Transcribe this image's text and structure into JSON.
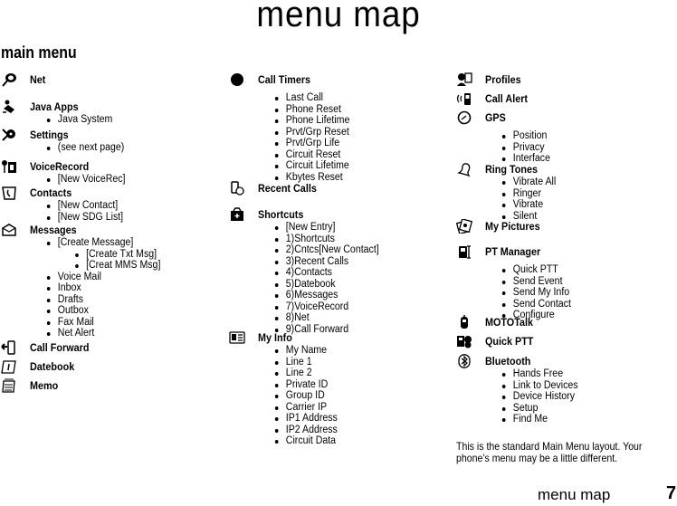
{
  "page": {
    "title": "menu map",
    "section_title": "main menu",
    "note": "This is the standard Main Menu layout. Your phone’s menu may be a little different.",
    "footer_label": "menu map",
    "page_number": "7"
  },
  "columns": [
    {
      "entries": [
        {
          "icon": "net-icon",
          "label": "Net",
          "items": []
        },
        {
          "icon": "java-apps-icon",
          "label": "Java Apps",
          "items": [
            {
              "text": "Java System"
            }
          ]
        },
        {
          "icon": "settings-icon",
          "label": "Settings",
          "items": [
            {
              "text": "(see next page)"
            }
          ]
        },
        {
          "icon": "voice-record-icon",
          "label": "VoiceRecord",
          "items": [
            {
              "text": "[New VoiceRec]"
            }
          ]
        },
        {
          "icon": "contacts-icon",
          "label": "Contacts",
          "items": [
            {
              "text": "[New Contact]"
            },
            {
              "text": "[New SDG List]"
            }
          ]
        },
        {
          "icon": "messages-icon",
          "label": "Messages",
          "items": [
            {
              "text": "[Create Message]",
              "children": [
                "[Create Txt Msg]",
                "[Creat MMS Msg]"
              ]
            },
            {
              "text": "Voice Mail"
            },
            {
              "text": "Inbox"
            },
            {
              "text": "Drafts"
            },
            {
              "text": "Outbox"
            },
            {
              "text": "Fax Mail"
            },
            {
              "text": "Net Alert"
            }
          ]
        },
        {
          "icon": "call-forward-icon",
          "label": "Call Forward",
          "items": []
        },
        {
          "icon": "datebook-icon",
          "label": "Datebook",
          "items": []
        },
        {
          "icon": "memo-icon",
          "label": "Memo",
          "items": []
        }
      ]
    },
    {
      "entries": [
        {
          "icon": "call-timers-icon",
          "label": "Call Timers",
          "items": [
            {
              "text": "Last Call"
            },
            {
              "text": "Phone Reset"
            },
            {
              "text": "Phone Lifetime"
            },
            {
              "text": "Prvt/Grp Reset"
            },
            {
              "text": "Prvt/Grp Life"
            },
            {
              "text": "Circuit Reset"
            },
            {
              "text": "Circuit Lifetime"
            },
            {
              "text": "Kbytes Reset"
            }
          ]
        },
        {
          "icon": "recent-calls-icon",
          "label": "Recent Calls",
          "items": []
        },
        {
          "icon": "shortcuts-icon",
          "label": "Shortcuts",
          "items": [
            {
              "text": "[New Entry]"
            },
            {
              "text": "1)Shortcuts"
            },
            {
              "text": "2)Cntcs[New Contact]"
            },
            {
              "text": "3)Recent Calls"
            },
            {
              "text": "4)Contacts"
            },
            {
              "text": "5)Datebook"
            },
            {
              "text": "6)Messages"
            },
            {
              "text": "7)VoiceRecord"
            },
            {
              "text": "8)Net"
            },
            {
              "text": "9)Call Forward"
            }
          ]
        },
        {
          "icon": "my-info-icon",
          "label": "My Info",
          "items": [
            {
              "text": "My Name"
            },
            {
              "text": "Line 1"
            },
            {
              "text": "Line 2"
            },
            {
              "text": "Private ID"
            },
            {
              "text": "Group ID"
            },
            {
              "text": "Carrier IP"
            },
            {
              "text": "IP1 Address"
            },
            {
              "text": "IP2 Address"
            },
            {
              "text": "Circuit Data"
            }
          ]
        }
      ]
    },
    {
      "entries": [
        {
          "icon": "profiles-icon",
          "label": "Profiles",
          "items": []
        },
        {
          "icon": "call-alert-icon",
          "label": "Call Alert",
          "items": []
        },
        {
          "icon": "gps-icon",
          "label": "GPS",
          "items": [
            {
              "text": "Position"
            },
            {
              "text": "Privacy"
            },
            {
              "text": "Interface"
            }
          ]
        },
        {
          "icon": "ring-tones-icon",
          "label": "Ring Tones",
          "items": [
            {
              "text": "Vibrate All"
            },
            {
              "text": "Ringer"
            },
            {
              "text": "Vibrate"
            },
            {
              "text": "Silent"
            }
          ]
        },
        {
          "icon": "my-pictures-icon",
          "label": "My Pictures",
          "items": []
        },
        {
          "icon": "pt-manager-icon",
          "label": "PT Manager",
          "items": [
            {
              "text": "Quick PTT"
            },
            {
              "text": "Send Event"
            },
            {
              "text": "Send My Info"
            },
            {
              "text": "Send Contact"
            },
            {
              "text": "Configure"
            }
          ]
        },
        {
          "icon": "mototalk-icon",
          "label": "MOTOTalk",
          "items": []
        },
        {
          "icon": "quick-ptt-icon",
          "label": "Quick PTT",
          "items": []
        },
        {
          "icon": "bluetooth-icon",
          "label": "Bluetooth",
          "items": [
            {
              "text": "Hands Free"
            },
            {
              "text": "Link to Devices"
            },
            {
              "text": "Device History"
            },
            {
              "text": "Setup"
            },
            {
              "text": "Find Me"
            }
          ]
        }
      ]
    }
  ]
}
